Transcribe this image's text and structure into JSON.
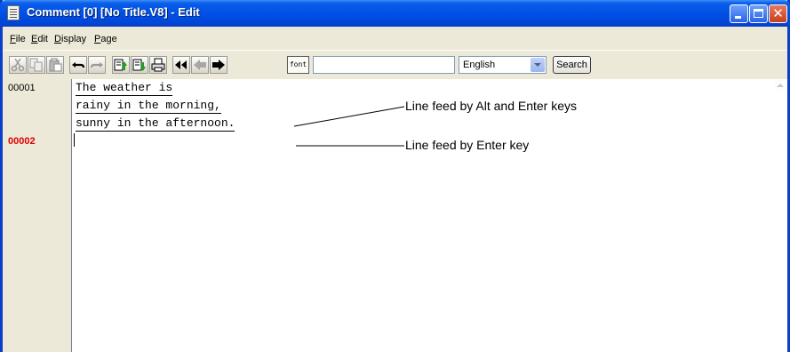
{
  "window": {
    "title": "Comment [0] [No Title.V8] - Edit",
    "controls": {
      "minimize": "–",
      "maximize": "□",
      "close": "✕"
    }
  },
  "menu": {
    "items": [
      {
        "label": "File",
        "mnemonic": "F"
      },
      {
        "label": "Edit",
        "mnemonic": "E"
      },
      {
        "label": "Display",
        "mnemonic": "D"
      },
      {
        "label": "Page",
        "mnemonic": "P"
      }
    ]
  },
  "toolbar": {
    "icons": [
      "cut-icon",
      "copy-icon",
      "paste-icon",
      "undo-icon",
      "redo-icon",
      "copy-to-clipboard-icon",
      "paste-from-clipboard-icon",
      "print-icon",
      "double-arrow-left-icon",
      "arrow-left-icon",
      "arrow-right-icon"
    ],
    "font_button": "font",
    "search_value": "",
    "language": "English",
    "search_button": "Search"
  },
  "editor": {
    "line_numbers": [
      {
        "number": "00001",
        "active": false
      },
      {
        "number": "00002",
        "active": true
      }
    ],
    "lines": [
      "The weather is",
      "rainy in the morning,",
      "sunny in the afternoon.",
      ""
    ]
  },
  "annotations": [
    "Line feed by Alt and Enter keys",
    "Line feed by Enter key"
  ],
  "colors": {
    "titlebar": "#0050e6",
    "active_line_number": "#e00000",
    "window_face": "#ece9d8"
  }
}
